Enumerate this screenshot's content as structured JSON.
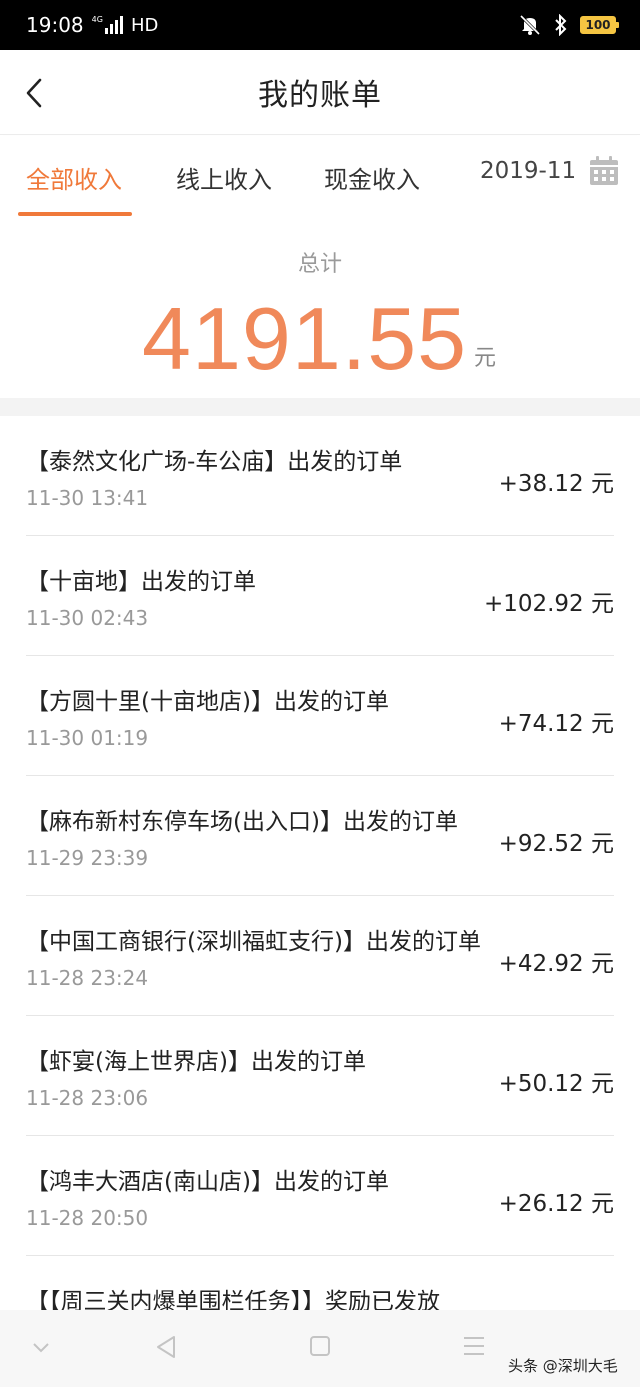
{
  "status": {
    "time": "19:08",
    "network": "4G",
    "hd": "HD",
    "battery": "100"
  },
  "nav": {
    "title": "我的账单"
  },
  "tabs": {
    "items": [
      "全部收入",
      "线上收入",
      "现金收入"
    ],
    "active": 0,
    "month": "2019-11"
  },
  "summary": {
    "label": "总计",
    "amount": "4191.55",
    "unit": "元"
  },
  "orders": [
    {
      "title": "【泰然文化广场-车公庙】出发的订单",
      "time": "11-30 13:41",
      "amount": "+38.12 元"
    },
    {
      "title": "【十亩地】出发的订单",
      "time": "11-30 02:43",
      "amount": "+102.92 元"
    },
    {
      "title": "【方圆十里(十亩地店)】出发的订单",
      "time": "11-30 01:19",
      "amount": "+74.12 元"
    },
    {
      "title": "【麻布新村东停车场(出入口)】出发的订单",
      "time": "11-29 23:39",
      "amount": "+92.52 元"
    },
    {
      "title": "【中国工商银行(深圳福虹支行)】出发的订单",
      "time": "11-28 23:24",
      "amount": "+42.92 元"
    },
    {
      "title": "【虾宴(海上世界店)】出发的订单",
      "time": "11-28 23:06",
      "amount": "+50.12 元"
    },
    {
      "title": "【鸿丰大酒店(南山店)】出发的订单",
      "time": "11-28 20:50",
      "amount": "+26.12 元"
    },
    {
      "title": "【【周三关内爆单围栏任务】】奖励已发放",
      "time": "",
      "amount": ""
    }
  ],
  "watermark": "头条 @深圳大毛",
  "colors": {
    "accent": "#f0793a",
    "amount": "#f0895a"
  }
}
